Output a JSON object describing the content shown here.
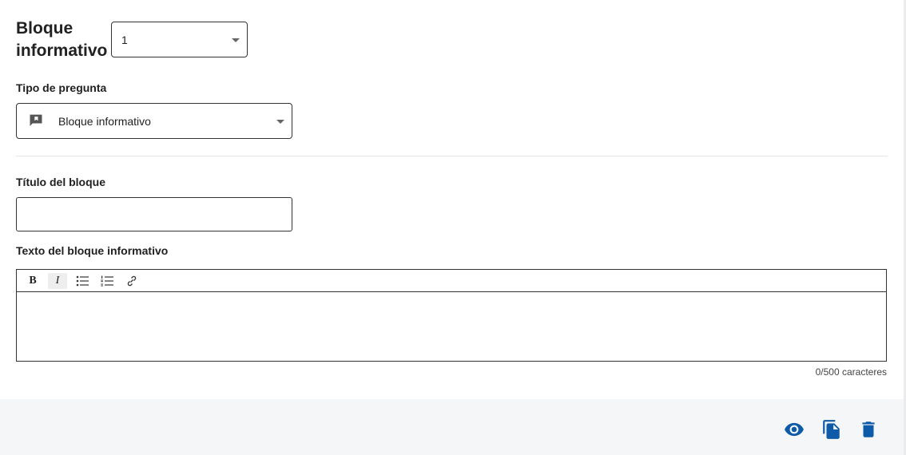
{
  "block": {
    "title_line1": "Bloque",
    "title_line2": "informativo",
    "number_value": "1"
  },
  "question_type": {
    "label": "Tipo de pregunta",
    "value": "Bloque informativo",
    "icon": "announcement-flag-icon"
  },
  "block_title": {
    "label": "Título del bloque",
    "value": ""
  },
  "block_text": {
    "label": "Texto del bloque informativo",
    "toolbar": [
      {
        "name": "bold-button",
        "glyph": "B"
      },
      {
        "name": "italic-button",
        "glyph": "I"
      },
      {
        "name": "bullet-list-button",
        "icon": "bullet-list-icon"
      },
      {
        "name": "numbered-list-button",
        "icon": "numbered-list-icon"
      },
      {
        "name": "link-button",
        "icon": "link-icon"
      }
    ],
    "counter": "0/500 caracteres"
  },
  "actions": [
    {
      "name": "preview-button",
      "icon": "eye-icon"
    },
    {
      "name": "duplicate-button",
      "icon": "copy-icon"
    },
    {
      "name": "delete-button",
      "icon": "trash-icon"
    }
  ],
  "colors": {
    "accent": "#0d5ba8",
    "footer_bg": "#f4f6f8",
    "border": "#333333"
  }
}
